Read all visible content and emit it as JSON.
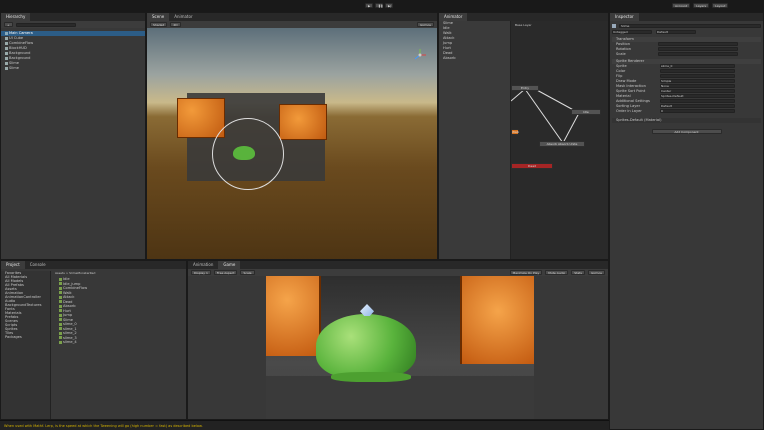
{
  "topbar": {
    "account": "Account",
    "layers": "Layers",
    "layout": "Layout"
  },
  "hierarchy": {
    "tab": "Hierarchy",
    "items": [
      "Main Camera",
      "UI Cube",
      "CombineFlow",
      "BlockHUD",
      "Background",
      "Background",
      "Slime",
      "Slime"
    ]
  },
  "scene": {
    "tabs": [
      "Scene",
      "Animator"
    ],
    "shading": "Shaded",
    "mode": "2D",
    "gizmos": "Gizmos"
  },
  "animator": {
    "tab": "Animator",
    "subtab": "Base Layer",
    "params": [
      "Slime",
      "Idle",
      "Walk",
      "Attack",
      "Jump",
      "Hurt",
      "Dead",
      "Absorb"
    ],
    "nodes": [
      "Entry",
      "Idle",
      "Walk",
      "Attack",
      "Absorb Absorb Unite",
      "Dead"
    ]
  },
  "inspector": {
    "tab": "Inspector",
    "name": "Slime",
    "tag": "Untagged",
    "layer": "Default",
    "transform": "Transform",
    "rows": [
      "Position",
      "Rotation",
      "Scale"
    ],
    "component": "Sprite Renderer",
    "props": [
      "Sprite",
      "Color",
      "Flip",
      "Draw Mode",
      "Mask Interaction",
      "Sprite Sort Point",
      "Material",
      "Additional Settings",
      "Sorting Layer",
      "Order in Layer"
    ],
    "values": [
      "slime_0",
      "",
      "",
      "Simple",
      "None",
      "Center",
      "Sprites-Default",
      "",
      "Default",
      "0"
    ],
    "material": "Sprites-Default (Material)",
    "add_component": "Add Component"
  },
  "project": {
    "tabs": [
      "Project",
      "Console"
    ],
    "tree": [
      "Favorites",
      "All Materials",
      "All Models",
      "All Prefabs",
      "Assets",
      "Animation",
      "AnimationController",
      "Audio",
      "BackgroundTextures",
      "Fonts",
      "Materials",
      "Prefabs",
      "Scenes",
      "Scripts",
      "Sprites",
      "Tiles",
      "Packages"
    ],
    "breadcrumb": "Assets > SlimeMonsterRed",
    "files": [
      "Idle",
      "Idle_jump",
      "CombineFlow",
      "Walk",
      "Attack",
      "Dead",
      "Absorb",
      "Hurt",
      "Jump",
      "Slime",
      "slime_0",
      "slime_1",
      "slime_2",
      "slime_3",
      "slime_4"
    ]
  },
  "game": {
    "tabs": [
      "Animation",
      "Game"
    ],
    "display": "Display 1",
    "aspect": "Free Aspect",
    "scale": "Scale",
    "buttons": [
      "Maximize On Play",
      "Mute Audio",
      "Stats",
      "Gizmos"
    ]
  },
  "status": {
    "message": "When used with Mathf. Lerp, is the speed at which the Tweening will go (high number = fast) as described below."
  },
  "colors": {
    "accent": "#2f5f8f",
    "lava": "#d9731f",
    "slime": "#59b33c",
    "red_node": "#a52525",
    "status_bar": "#c8a000"
  }
}
